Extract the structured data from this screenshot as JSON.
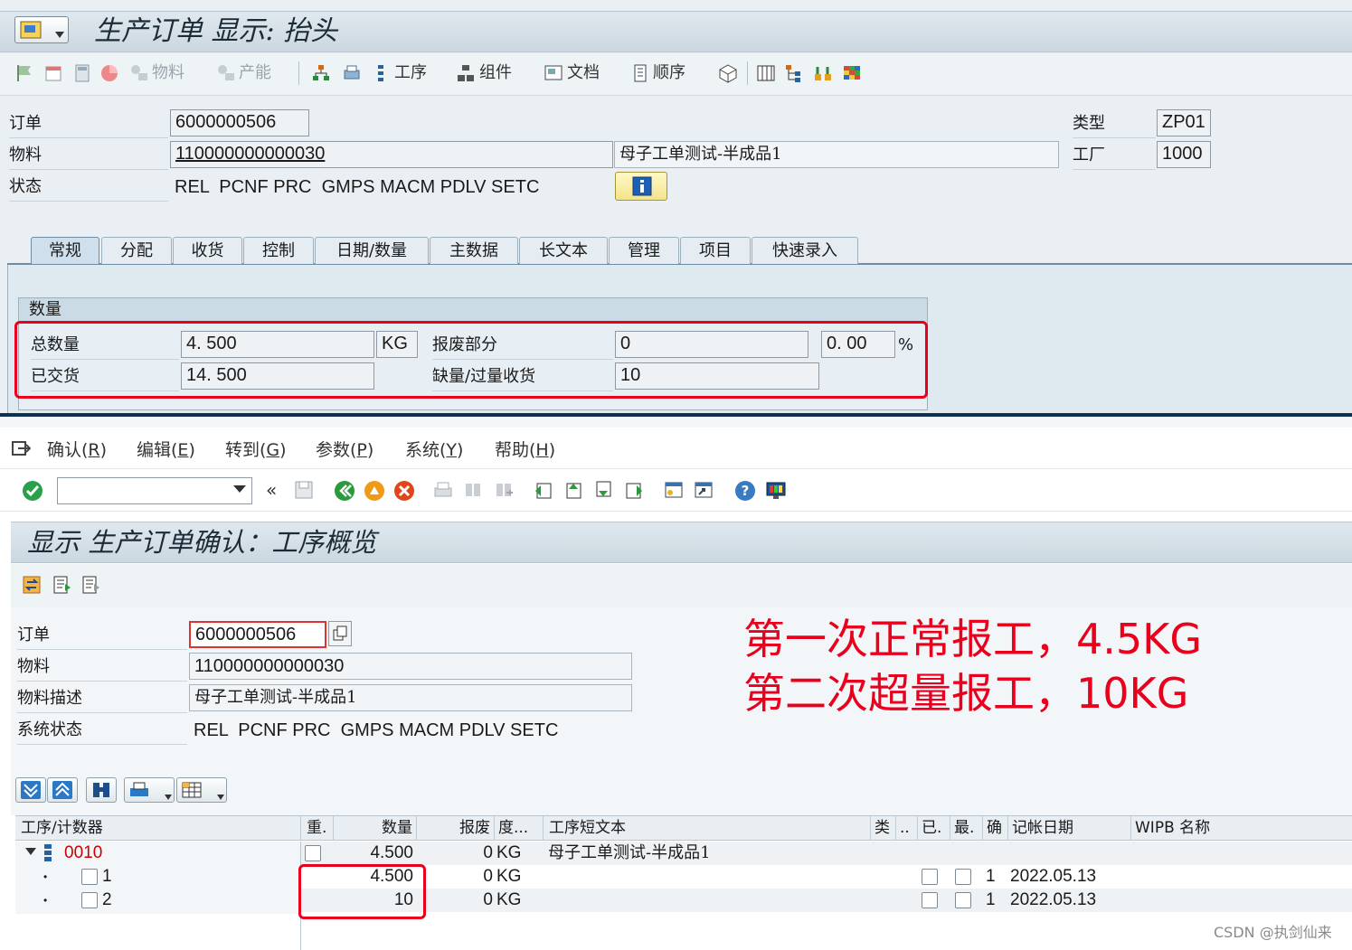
{
  "top": {
    "title": "生产订单 显示: 抬头",
    "toolbar": {
      "material_label": "物料",
      "capacity_label": "产能",
      "operation_label": "工序",
      "component_label": "组件",
      "document_label": "文档",
      "sequence_label": "顺序"
    },
    "header": {
      "order_label": "订单",
      "order_value": "6000000506",
      "material_label": "物料",
      "material_value": "110000000000030",
      "material_desc": "母子工单测试-半成品1",
      "status_label": "状态",
      "status_value": "REL  PCNF PRC  GMPS MACM PDLV SETC",
      "type_label": "类型",
      "type_value": "ZP01",
      "plant_label": "工厂",
      "plant_value": "1000"
    },
    "tabs": [
      {
        "label": "常规"
      },
      {
        "label": "分配"
      },
      {
        "label": "收货"
      },
      {
        "label": "控制"
      },
      {
        "label": "日期/数量"
      },
      {
        "label": "主数据"
      },
      {
        "label": "长文本"
      },
      {
        "label": "管理"
      },
      {
        "label": "项目"
      },
      {
        "label": "快速录入"
      }
    ],
    "quantity": {
      "group_title": "数量",
      "total_label": "总数量",
      "total_value": "4. 500",
      "unit": "KG",
      "scrap_label": "报废部分",
      "scrap_value": "0",
      "scrap_pct": "0. 00",
      "pct_sign": "%",
      "delivered_label": "已交货",
      "delivered_value": "14. 500",
      "shortage_label": "缺量/过量收货",
      "shortage_value": "10"
    }
  },
  "bottom": {
    "menu": [
      {
        "label": "确认(",
        "key": "R",
        "end": ")"
      },
      {
        "label": "编辑(",
        "key": "E",
        "end": ")"
      },
      {
        "label": "转到(",
        "key": "G",
        "end": ")"
      },
      {
        "label": "参数(",
        "key": "P",
        "end": ")"
      },
      {
        "label": "系统(",
        "key": "Y",
        "end": ")"
      },
      {
        "label": "帮助(",
        "key": "H",
        "end": ")"
      }
    ],
    "title": "显示 生产订单确认：工序概览",
    "fields": {
      "order_label": "订单",
      "order_value": "6000000506",
      "material_label": "物料",
      "material_value": "110000000000030",
      "desc_label": "物料描述",
      "desc_value": "母子工单测试-半成品1",
      "status_label": "系统状态",
      "status_value": "REL  PCNF PRC  GMPS MACM PDLV SETC"
    },
    "table": {
      "headers": [
        "工序/计数器",
        "重.",
        "数量",
        "报废",
        "度...",
        "工序短文本",
        "类",
        "..",
        "已.",
        "最.",
        "确",
        "记帐日期",
        "WIPB 名称"
      ],
      "parent": {
        "op": "0010",
        "qty": "4.500",
        "scrap": "0",
        "unit": "KG",
        "text": "母子工单测试-半成品1"
      },
      "rows": [
        {
          "counter": "1",
          "qty": "4.500",
          "scrap": "0",
          "unit": "KG",
          "confirm": "1",
          "date": "2022.05.13"
        },
        {
          "counter": "2",
          "qty": "10",
          "scrap": "0",
          "unit": "KG",
          "confirm": "1",
          "date": "2022.05.13"
        }
      ]
    },
    "annotation": {
      "line1": "第一次正常报工，4.5KG",
      "line2": "第二次超量报工，10KG"
    },
    "watermark": "CSDN @执剑仙来"
  }
}
